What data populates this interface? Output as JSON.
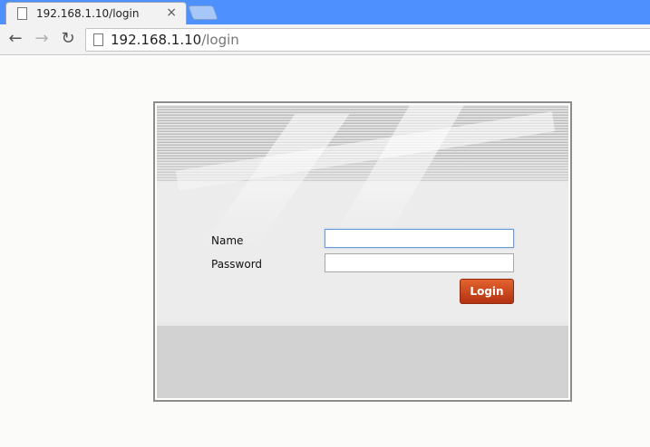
{
  "browser": {
    "tab_title": "192.168.1.10/login",
    "url_host": "192.168.1.10",
    "url_path": "/login"
  },
  "login": {
    "name_label": "Name",
    "password_label": "Password",
    "name_value": "",
    "password_value": "",
    "button_label": "Login",
    "accent_color": "#c9461f"
  }
}
